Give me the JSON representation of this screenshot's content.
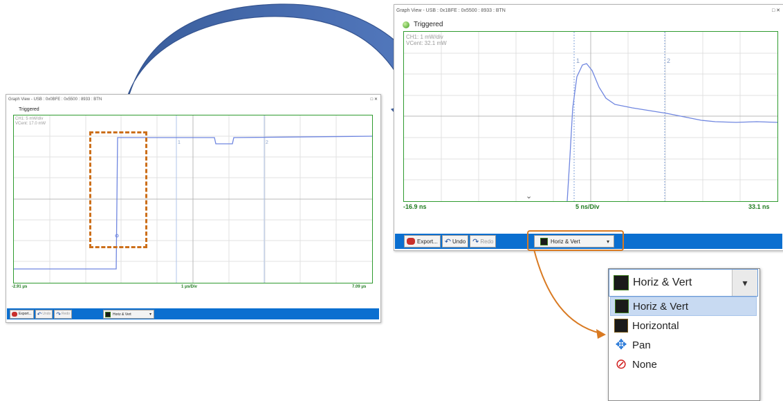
{
  "small_window": {
    "title": "Graph View - USB : 0x0BFE : 0x5500 : 8933 : BTN",
    "window_buttons": "□  ✕",
    "status": "Triggered",
    "ch_info": [
      "CH1: 5 mW/div",
      "VCent: 17.0 mW"
    ],
    "marker1": "1",
    "marker2": "2",
    "x_left": "-2.91 μs",
    "x_center": "1 μs/Div",
    "x_right": "7.09 μs",
    "export_label": "Export...",
    "undo_label": "Undo",
    "redo_label": "Redo",
    "zoom_mode": "Horiz & Vert",
    "dropdown_arrow": "▾"
  },
  "large_window": {
    "title": "Graph View - USB : 0x1BFE : 0x5500 : 8933 : BTN",
    "window_buttons": "□  ✕",
    "status": "Triggered",
    "ch_info": [
      "CH1: 1 mW/div",
      "VCent: 32.1 mW"
    ],
    "marker1": "1",
    "marker2": "2",
    "x_left": "-16.9 ns",
    "x_center": "5 ns/Div",
    "x_right": "33.1 ns",
    "export_label": "Export...",
    "undo_label": "Undo",
    "redo_label": "Redo",
    "zoom_mode": "Horiz & Vert",
    "dropdown_arrow": "▾"
  },
  "zoom_dropdown": {
    "selected": "Horiz & Vert",
    "arrow": "▾",
    "options": [
      "Horiz & Vert",
      "Horizontal",
      "Pan",
      "None"
    ]
  },
  "colors": {
    "trace": "#6f86e0",
    "grid_border": "#2e9a2e",
    "toolbar": "#0b6fd0",
    "curved_arrow": "#3a62aa",
    "highlight": "#d97a22",
    "dashed_box": "#cc6f1a"
  },
  "icons": [
    "export-icon",
    "undo-icon",
    "redo-icon",
    "horiz-vert-icon",
    "horizontal-icon",
    "pan-icon",
    "none-icon"
  ]
}
